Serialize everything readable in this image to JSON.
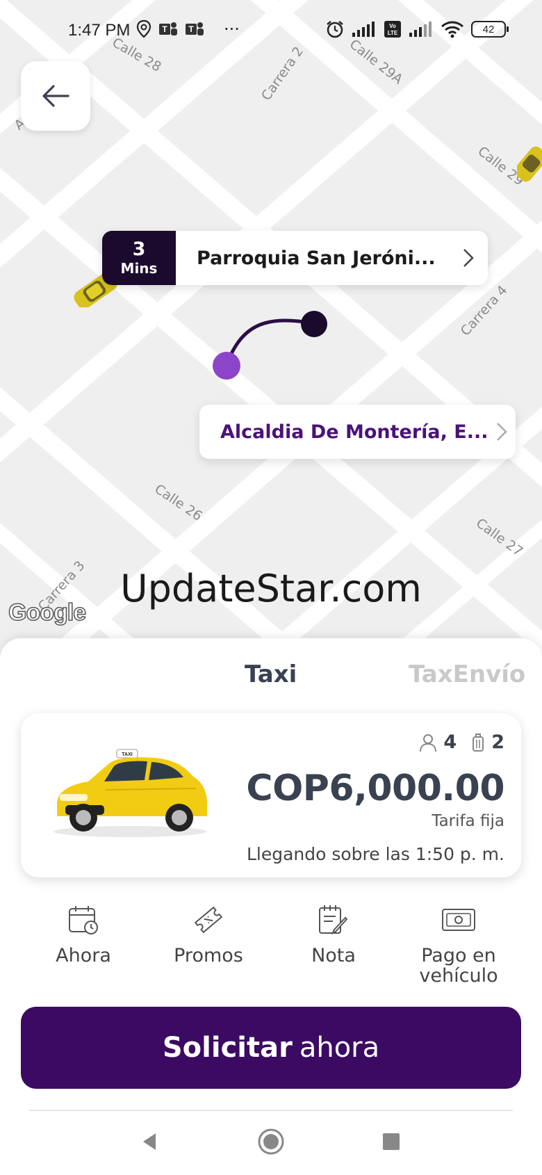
{
  "status_bar": {
    "time": "1:47 PM",
    "dots": "···",
    "battery": "42",
    "left_icons": [
      "location-icon",
      "teams-icon",
      "teams-icon"
    ],
    "right_icons": [
      "alarm-icon",
      "signal-icon",
      "volte-icon",
      "signal-icon",
      "wifi-icon",
      "battery-icon"
    ]
  },
  "map": {
    "streets": [
      "Calle 28",
      "Carrera 2",
      "Calle 29A",
      "Calle 29",
      "Carrera 4",
      "Calle 26",
      "Calle 27",
      "Carrera 3",
      "A"
    ],
    "origin": {
      "eta_value": "3",
      "eta_unit": "Mins",
      "name": "Parroquia San Jeróni..."
    },
    "destination": {
      "name": "Alcaldia De Montería, E..."
    },
    "watermark": "UpdateStar.com",
    "provider_logo": "Google",
    "colors": {
      "route": "#2a0f45",
      "origin_dot": "#1b0a2e",
      "destination_dot": "#8c44c9"
    }
  },
  "sheet": {
    "tabs": [
      {
        "label": "Taxi",
        "active": true
      },
      {
        "label": "TaxEnvío",
        "active": false
      }
    ],
    "ride": {
      "car_badge": "TAXI",
      "passengers": "4",
      "luggage": "2",
      "price": "COP6,000.00",
      "fare_type": "Tarifa fija",
      "arrival": "Llegando sobre las 1:50 p. m."
    },
    "options": [
      {
        "label": "Ahora",
        "icon": "calendar-clock-icon"
      },
      {
        "label": "Promos",
        "icon": "ticket-icon"
      },
      {
        "label": "Nota",
        "icon": "note-pencil-icon"
      },
      {
        "label": "Pago en vehículo",
        "icon": "cash-icon"
      }
    ],
    "request_button": {
      "bold": "Solicitar",
      "regular": "ahora"
    }
  },
  "colors": {
    "primary": "#3b0a62",
    "eta_bg": "#1b0a2e",
    "destination_text": "#4a1279",
    "tab_active": "#3a4150",
    "tab_inactive": "#c9c9c9"
  }
}
